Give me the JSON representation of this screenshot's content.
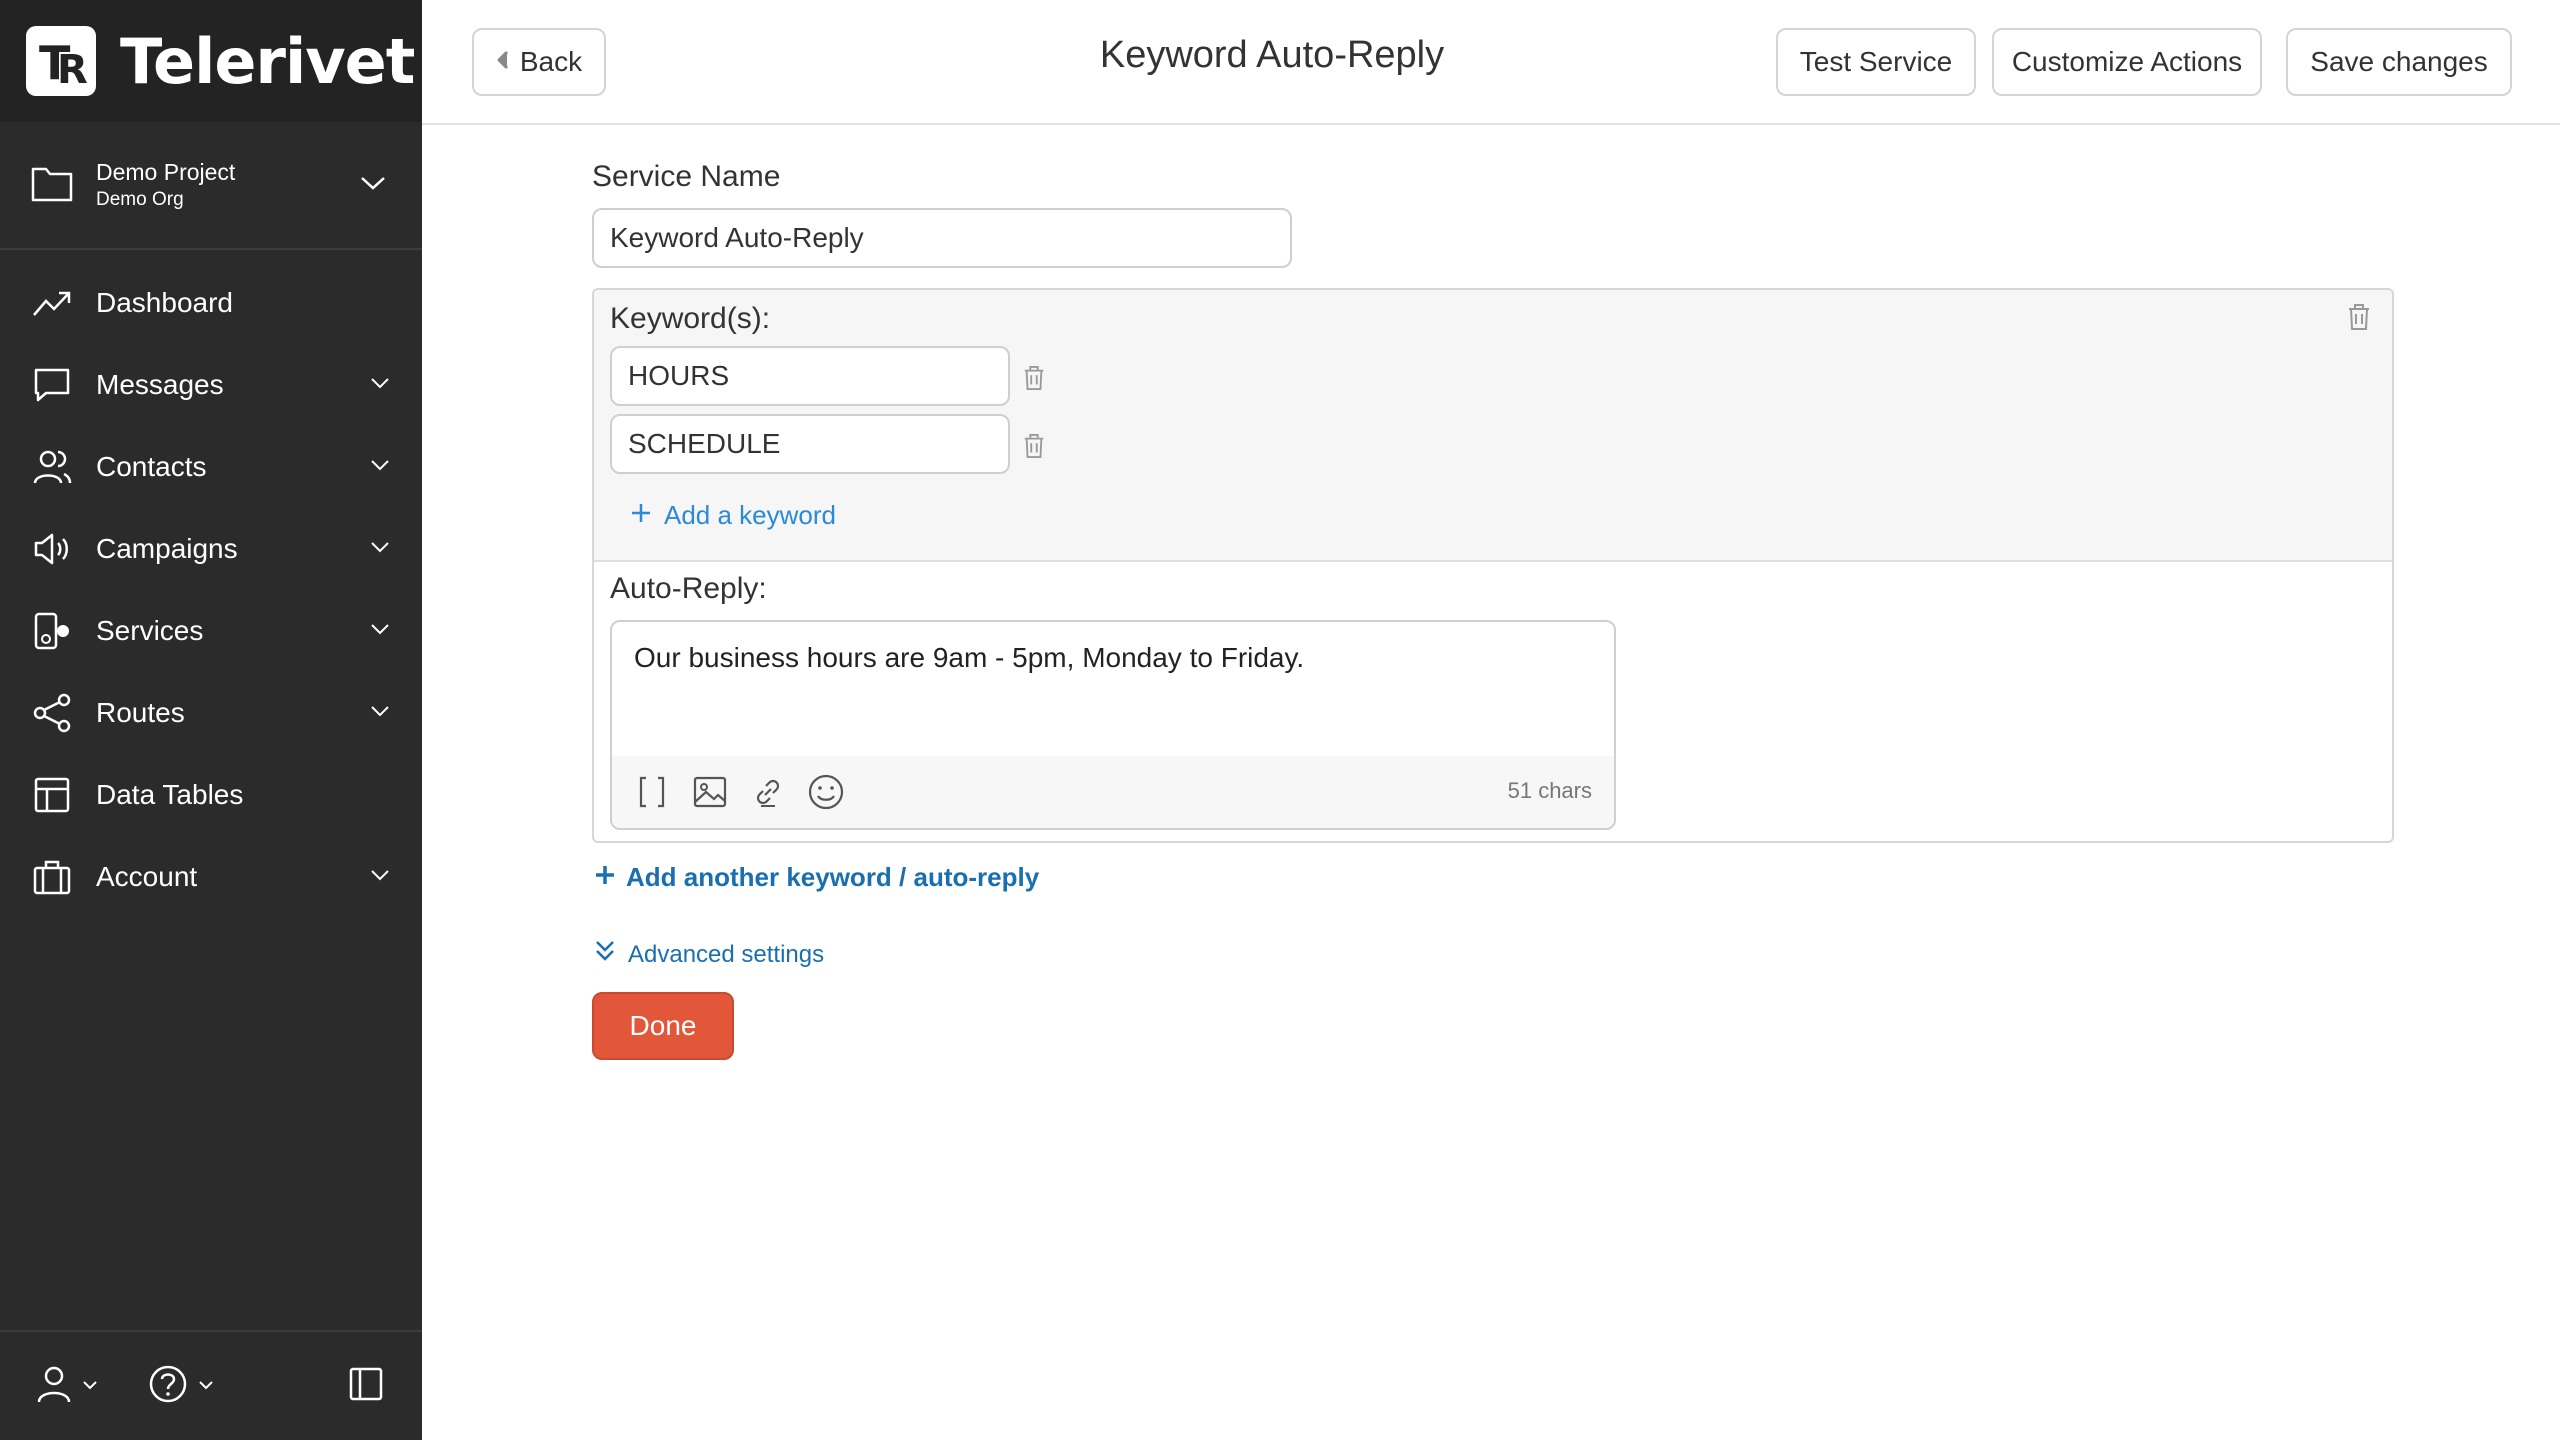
{
  "brand": {
    "name": "Telerivet",
    "logo_icon": "telerivet-logo"
  },
  "project": {
    "name": "Demo Project",
    "org": "Demo Org"
  },
  "nav": {
    "items": [
      {
        "label": "Dashboard",
        "icon": "trend-icon",
        "has_submenu": false
      },
      {
        "label": "Messages",
        "icon": "chat-icon",
        "has_submenu": true
      },
      {
        "label": "Contacts",
        "icon": "people-icon",
        "has_submenu": true
      },
      {
        "label": "Campaigns",
        "icon": "megaphone-icon",
        "has_submenu": true
      },
      {
        "label": "Services",
        "icon": "services-icon",
        "has_submenu": true
      },
      {
        "label": "Routes",
        "icon": "share-icon",
        "has_submenu": true
      },
      {
        "label": "Data Tables",
        "icon": "table-icon",
        "has_submenu": false
      },
      {
        "label": "Account",
        "icon": "briefcase-icon",
        "has_submenu": true
      }
    ]
  },
  "toolbar": {
    "back_label": "Back",
    "title": "Keyword Auto-Reply",
    "test_label": "Test Service",
    "customize_label": "Customize Actions",
    "save_label": "Save changes"
  },
  "form": {
    "service_name_label": "Service Name",
    "service_name_value": "Keyword Auto-Reply",
    "keywords_label": "Keyword(s):",
    "keywords": [
      "HOURS",
      "SCHEDULE"
    ],
    "add_keyword_label": "Add a keyword",
    "auto_reply_label": "Auto-Reply:",
    "auto_reply_text": "Our business hours are 9am - 5pm, Monday to Friday.",
    "char_count": "51 chars",
    "add_another_label": "Add another keyword / auto-reply",
    "advanced_label": "Advanced settings",
    "done_label": "Done"
  },
  "colors": {
    "sidebar_bg": "#2b2b2b",
    "brand_bg": "#232323",
    "accent_orange": "#e2573a",
    "link_blue": "#2a8ad8",
    "link_dark_blue": "#1a6fb0"
  }
}
